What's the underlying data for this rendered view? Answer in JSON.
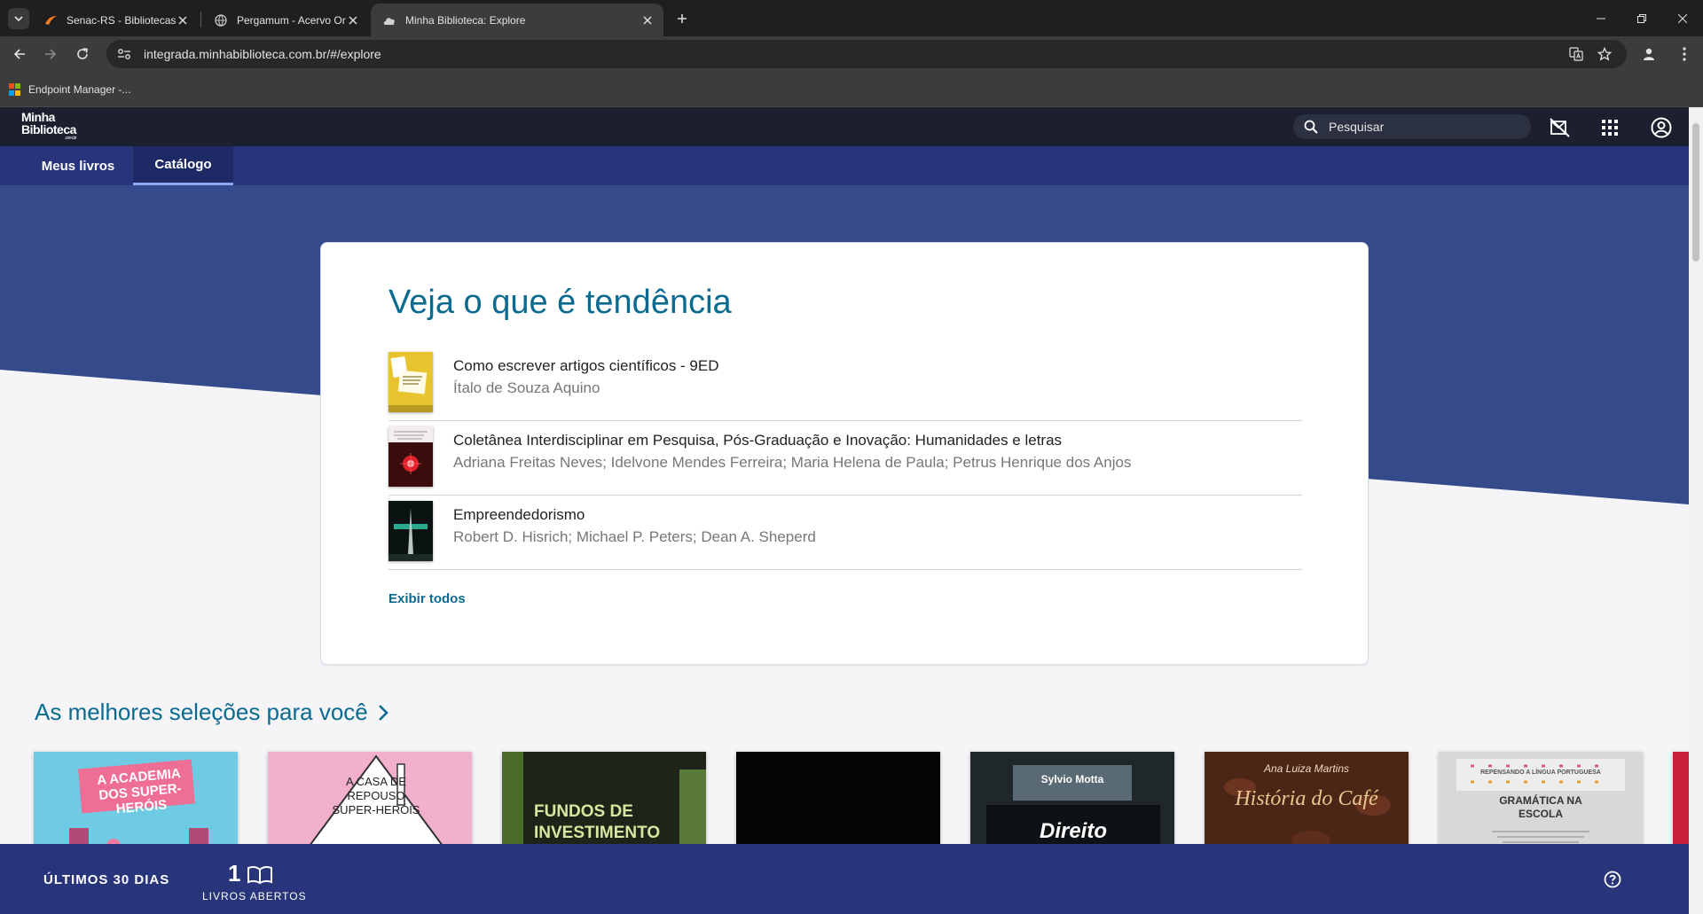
{
  "browser": {
    "tabs": [
      {
        "title": "Senac-RS - Bibliotecas",
        "favicon": "senac-favicon"
      },
      {
        "title": "Pergamum - Acervo Online",
        "favicon": "globe-icon"
      },
      {
        "title": "Minha Biblioteca: Explore",
        "favicon": "cloud-icon"
      }
    ],
    "url": "integrada.minhabiblioteca.com.br/#/explore",
    "bookmarks": [
      {
        "label": "Endpoint Manager -..."
      }
    ]
  },
  "site": {
    "logo": {
      "line1": "Minha",
      "line2": "Biblioteca",
      "sub": ".com.br"
    },
    "search_placeholder": "Pesquisar",
    "nav_tabs": [
      {
        "label": "Meus livros",
        "active": false
      },
      {
        "label": "Catálogo",
        "active": true
      }
    ],
    "trending": {
      "title": "Veja o que é tendência",
      "items": [
        {
          "title": "Como escrever artigos científicos - 9ED",
          "author": "Ítalo de Souza Aquino"
        },
        {
          "title": "Coletânea Interdisciplinar em Pesquisa, Pós-Graduação e Inovação: Humanidades e letras",
          "author": "Adriana Freitas Neves; Idelvone Mendes Ferreira; Maria Helena de Paula; Petrus Henrique dos Anjos"
        },
        {
          "title": "Empreendedorismo",
          "author": "Robert D. Hisrich; Michael P. Peters; Dean A. Sheperd"
        }
      ],
      "show_all": "Exibir todos"
    },
    "selections": {
      "heading": "As melhores seleções para você",
      "books": [
        {
          "cover_text": "A ACADEMIA DOS SUPER-HERÓIS"
        },
        {
          "cover_text": "A CASA DE REPOUSO SUPER-HERÓIS"
        },
        {
          "cover_text": "FUNDOS DE INVESTIMENTO"
        },
        {
          "cover_text": ""
        },
        {
          "cover_author": "Sylvio Motta",
          "cover_text": "Direito"
        },
        {
          "cover_author": "Ana Luiza Martins",
          "cover_text": "História do Café"
        },
        {
          "cover_text": "GRAMÁTICA NA ESCOLA",
          "cover_series": "REPENSANDO A LÍNGUA PORTUGUESA"
        }
      ]
    },
    "footer": {
      "period": "ÚLTIMOS 30 DIAS",
      "count": "1",
      "count_label": "LIVROS ABERTOS"
    }
  },
  "colors": {
    "brand_dark": "#1b1f2e",
    "brand_blue": "#28357a",
    "accent_teal": "#0b6a8f"
  }
}
